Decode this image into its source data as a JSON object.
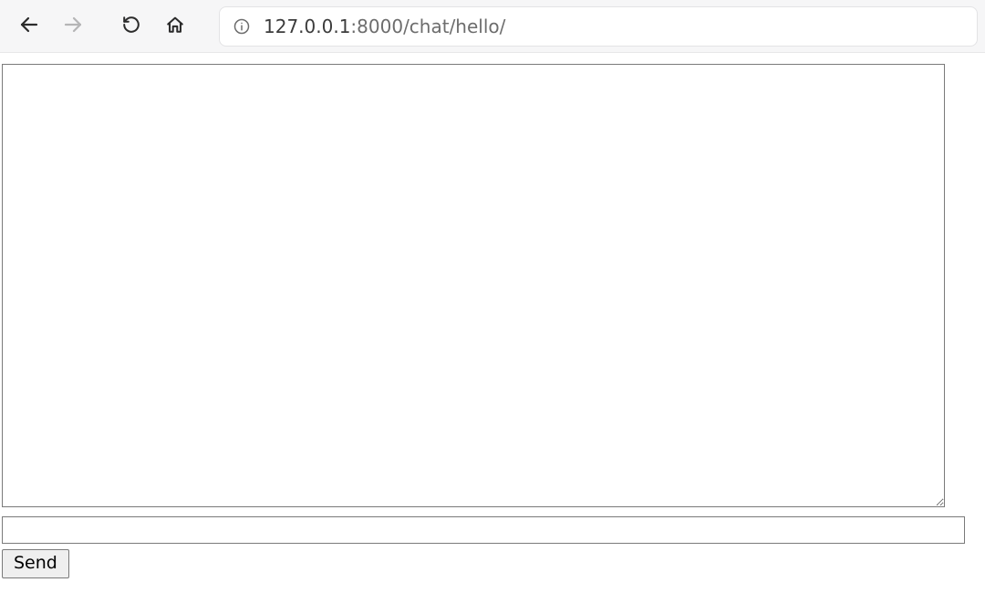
{
  "browser": {
    "url": {
      "host": "127.0.0.1",
      "port": ":8000",
      "path": "/chat/hello/"
    }
  },
  "chat": {
    "log_value": "",
    "input_value": "",
    "send_label": "Send"
  }
}
